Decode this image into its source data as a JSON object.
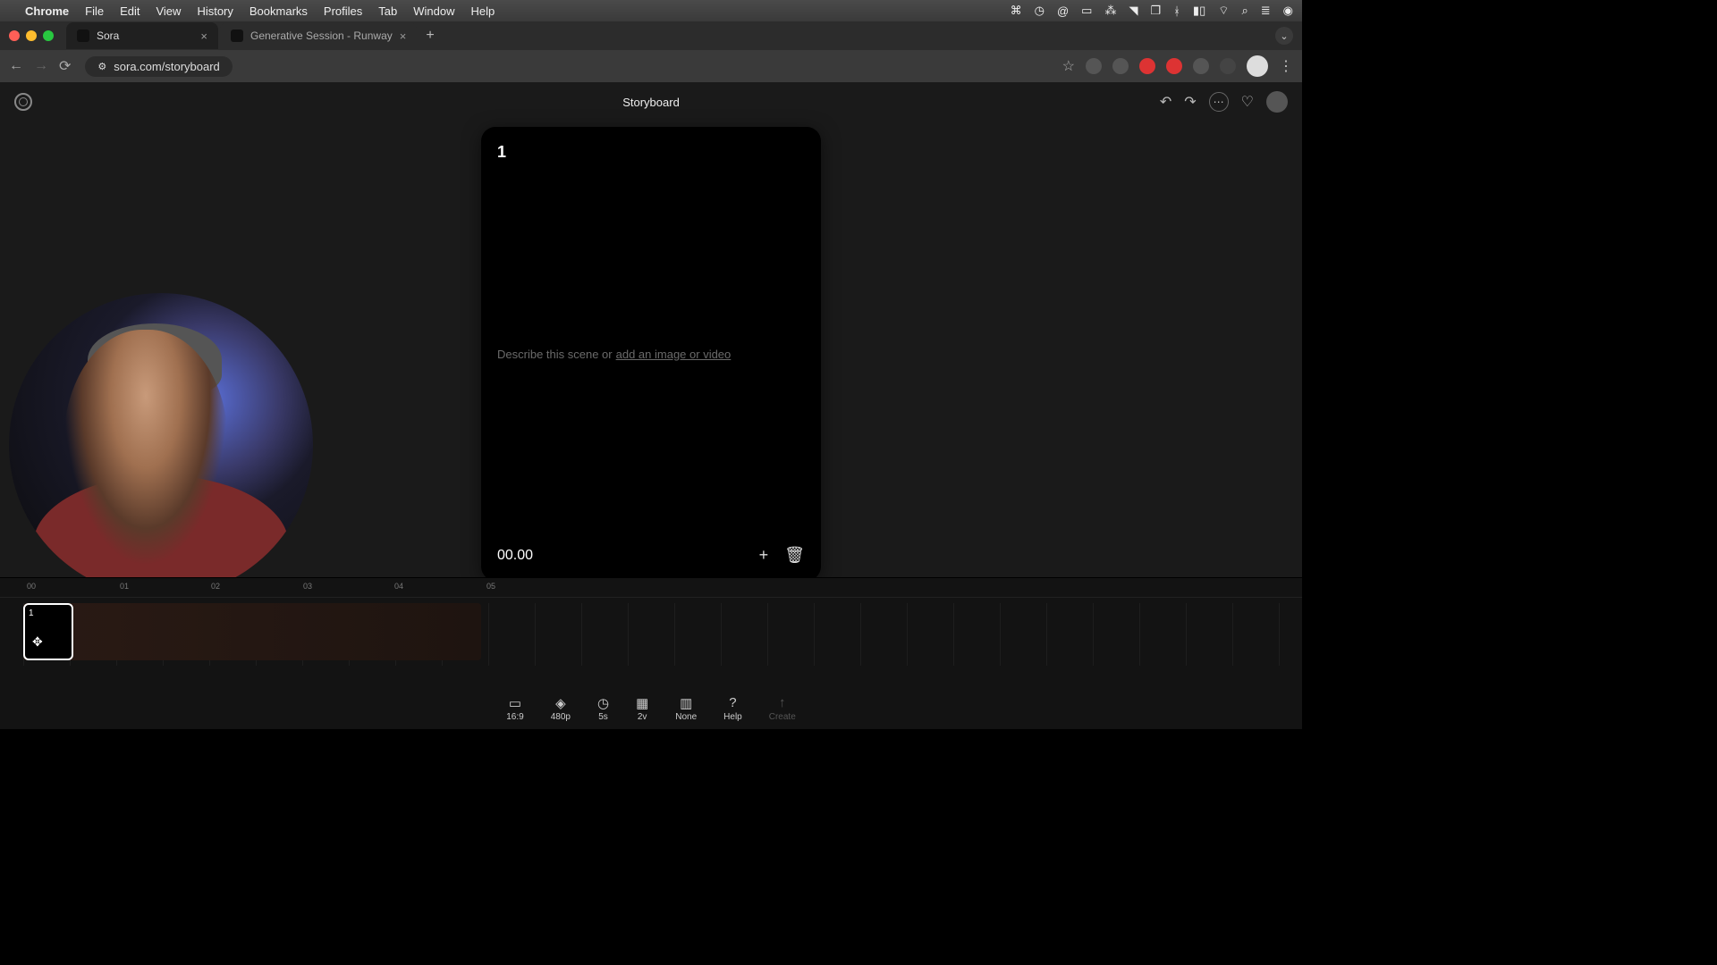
{
  "menubar": {
    "app": "Chrome",
    "items": [
      "File",
      "Edit",
      "View",
      "History",
      "Bookmarks",
      "Profiles",
      "Tab",
      "Window",
      "Help"
    ]
  },
  "tabs": [
    {
      "title": "Sora"
    },
    {
      "title": "Generative Session - Runway"
    }
  ],
  "address": {
    "url": "sora.com/storyboard"
  },
  "header": {
    "title": "Storyboard"
  },
  "card": {
    "number": "1",
    "placeholder_prefix": "Describe this scene or",
    "placeholder_link": "add an image or video",
    "timestamp": "00.00"
  },
  "timeline": {
    "ticks": [
      "00",
      "01",
      "02",
      "03",
      "04",
      "05"
    ],
    "clip_label": "1"
  },
  "toolbar": {
    "aspect": {
      "label": "16:9"
    },
    "res": {
      "label": "480p"
    },
    "dur": {
      "label": "5s"
    },
    "var": {
      "label": "2v"
    },
    "style": {
      "label": "None"
    },
    "help": {
      "label": "Help"
    },
    "create": {
      "label": "Create"
    }
  }
}
